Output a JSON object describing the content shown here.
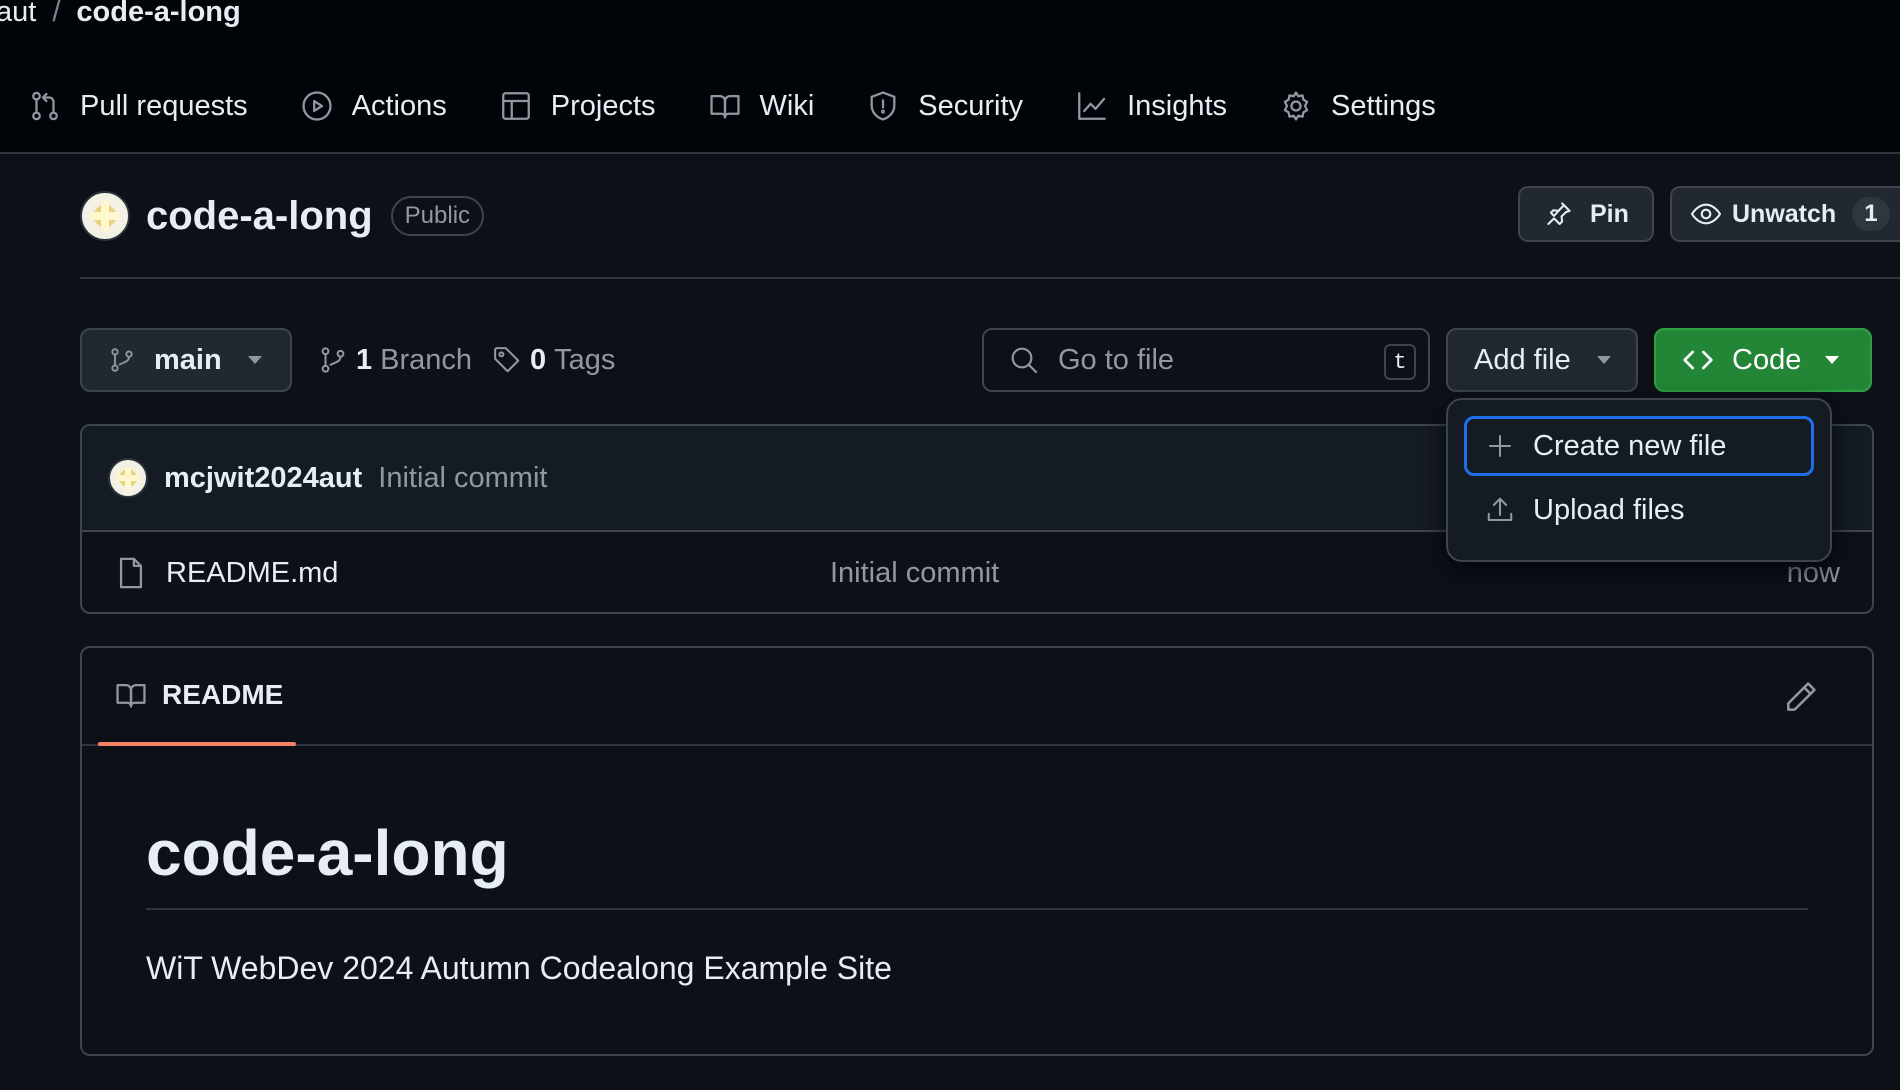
{
  "breadcrumb": {
    "owner": "aut",
    "separator": "/",
    "repo": "code-a-long"
  },
  "nav": {
    "items": [
      {
        "label": "Pull requests",
        "icon": "git-pull-request-icon"
      },
      {
        "label": "Actions",
        "icon": "play-icon"
      },
      {
        "label": "Projects",
        "icon": "table-icon"
      },
      {
        "label": "Wiki",
        "icon": "book-icon"
      },
      {
        "label": "Security",
        "icon": "shield-icon"
      },
      {
        "label": "Insights",
        "icon": "graph-icon"
      },
      {
        "label": "Settings",
        "icon": "gear-icon"
      }
    ]
  },
  "repo": {
    "name": "code-a-long",
    "visibility": "Public"
  },
  "actions": {
    "pin_label": "Pin",
    "unwatch_label": "Unwatch",
    "unwatch_count": "1"
  },
  "branch": {
    "current": "main",
    "branch_count": "1",
    "branch_label": "Branch",
    "tag_count": "0",
    "tag_label": "Tags"
  },
  "search": {
    "placeholder": "Go to file",
    "shortcut": "t"
  },
  "buttons": {
    "add_file": "Add file",
    "code": "Code"
  },
  "add_file_menu": {
    "items": [
      {
        "label": "Create new file",
        "icon": "plus-icon"
      },
      {
        "label": "Upload files",
        "icon": "upload-icon"
      }
    ]
  },
  "latest_commit": {
    "author": "mcjwit2024aut",
    "message": "Initial commit"
  },
  "files": [
    {
      "name": "README.md",
      "commit_message": "Initial commit",
      "time": "now"
    }
  ],
  "readme": {
    "tab_label": "README",
    "heading": "code-a-long",
    "paragraph": "WiT WebDev 2024 Autumn Codealong Example Site"
  },
  "colors": {
    "accent_blue": "#1f6feb",
    "code_green": "#238636",
    "tab_underline": "#f78166",
    "background": "#0d1117",
    "header_background": "#010409"
  }
}
